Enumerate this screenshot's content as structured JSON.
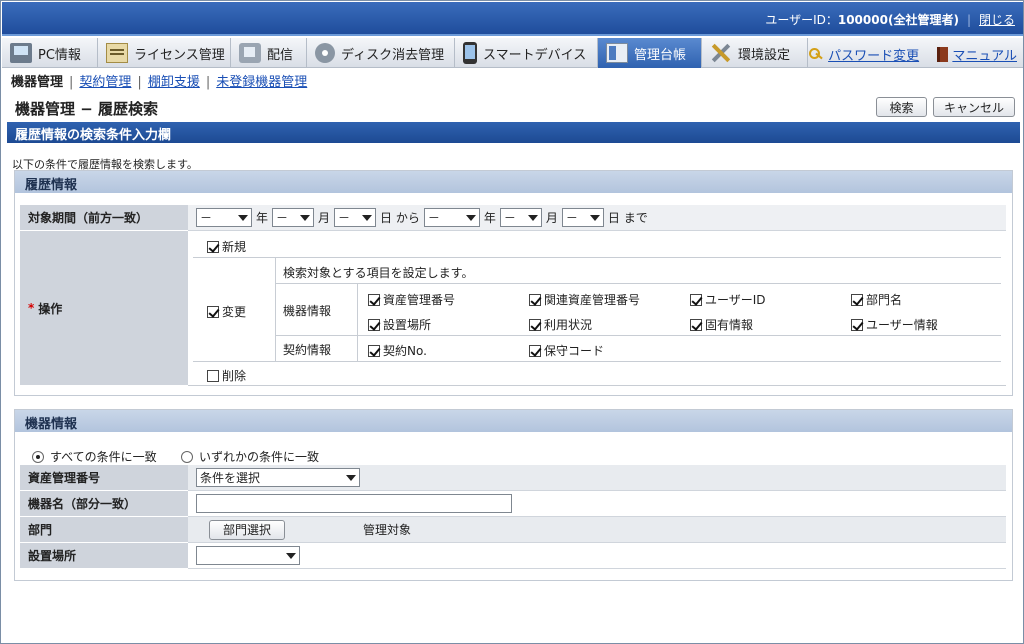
{
  "topbar": {
    "user_label": "ユーザーID：",
    "user_value": "100000(全社管理者)",
    "logout": "閉じる"
  },
  "tabs": [
    {
      "label": "PC情報",
      "icon": "pc-icon"
    },
    {
      "label": "ライセンス管理",
      "icon": "license-icon"
    },
    {
      "label": "配信",
      "icon": "distribution-icon"
    },
    {
      "label": "ディスク消去管理",
      "icon": "disk-icon"
    },
    {
      "label": "スマートデバイス",
      "icon": "smartphone-icon"
    },
    {
      "label": "管理台帳",
      "icon": "ledger-icon",
      "active": true
    },
    {
      "label": "環境設定",
      "icon": "tools-icon"
    }
  ],
  "tab_links": {
    "password": "パスワード変更",
    "manual": "マニュアル"
  },
  "subnav": {
    "current": "機器管理",
    "contract": "契約管理",
    "inventory": "棚卸支援",
    "unregistered": "未登録機器管理",
    "separator": "|"
  },
  "page": {
    "title": "機器管理 − 履歴検索",
    "search_button": "検索",
    "cancel_button": "キャンセル"
  },
  "panel": {
    "title": "履歴情報の検索条件入力欄",
    "description": "以下の条件で履歴情報を検索します。"
  },
  "history": {
    "header": "履歴情報",
    "period_label": "対象期間（前方一致）",
    "dash": "－",
    "year": "年",
    "month": "月",
    "day_from": "日 から",
    "day_to": "日 まで",
    "required_mark": "*",
    "operation_label": "操作",
    "new_label": "新規",
    "new_checked": true,
    "change_label": "変更",
    "change_checked": true,
    "item_hint": "検索対象とする項目を設定します。",
    "device_info_label": "機器情報",
    "device_items": [
      {
        "label": "資産管理番号",
        "checked": true
      },
      {
        "label": "関連資産管理番号",
        "checked": true
      },
      {
        "label": "ユーザーID",
        "checked": true
      },
      {
        "label": "部門名",
        "checked": true
      },
      {
        "label": "設置場所",
        "checked": true
      },
      {
        "label": "利用状況",
        "checked": true
      },
      {
        "label": "固有情報",
        "checked": true
      },
      {
        "label": "ユーザー情報",
        "checked": true
      }
    ],
    "contract_info_label": "契約情報",
    "contract_items": [
      {
        "label": "契約No.",
        "checked": true
      },
      {
        "label": "保守コード",
        "checked": true
      }
    ],
    "delete_label": "削除",
    "delete_checked": false
  },
  "device": {
    "header": "機器情報",
    "match_all": "すべての条件に一致",
    "match_any": "いずれかの条件に一致",
    "match_all_selected": true,
    "asset_label": "資産管理番号",
    "asset_select": "条件を選択",
    "name_label": "機器名（部分一致）",
    "name_value": "",
    "dept_label": "部門",
    "dept_button": "部門選択",
    "dept_value": "管理対象",
    "location_label": "設置場所",
    "location_select": ""
  }
}
